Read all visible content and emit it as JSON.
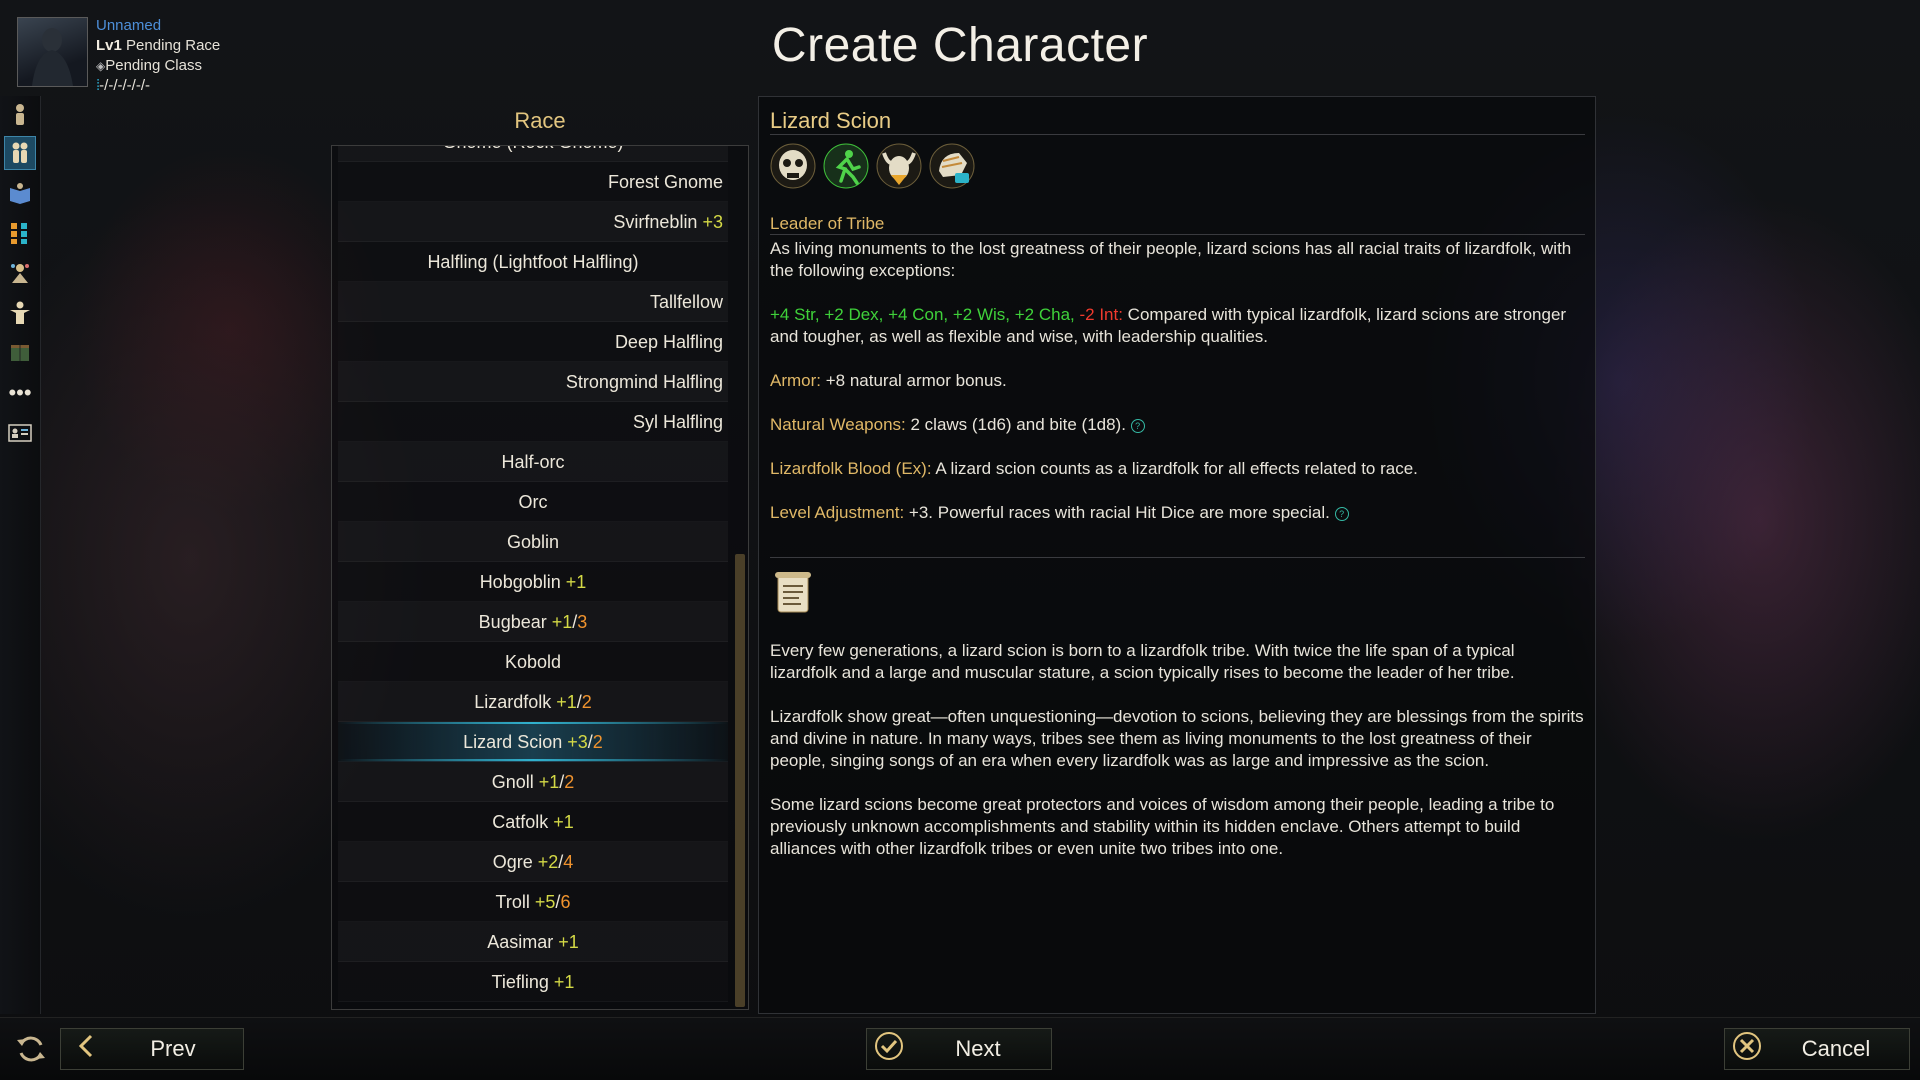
{
  "window": {
    "title": "Create Character"
  },
  "character": {
    "name": "Unnamed",
    "level_prefix": "Lv1",
    "race": "Pending Race",
    "class": "Pending Class",
    "stats": "-/-/-/-/-/-"
  },
  "sidebar": {
    "items": [
      {
        "name": "character-icon"
      },
      {
        "name": "race-icon"
      },
      {
        "name": "class-book-icon"
      },
      {
        "name": "abilities-grid-icon"
      },
      {
        "name": "skills-icon"
      },
      {
        "name": "feats-icon"
      },
      {
        "name": "spellbook-icon"
      },
      {
        "name": "more-icon"
      },
      {
        "name": "summary-card-icon"
      }
    ]
  },
  "race_panel": {
    "header": "Race",
    "rows": [
      {
        "label": "Gnome (Rock Gnome)",
        "a1": "",
        "sep": "",
        "a2": "",
        "align": "center"
      },
      {
        "label": "Forest Gnome",
        "a1": "",
        "sep": "",
        "a2": "",
        "align": "right"
      },
      {
        "label": "Svirfneblin",
        "a1": "+3",
        "sep": "",
        "a2": "",
        "align": "right"
      },
      {
        "label": "Halfling (Lightfoot Halfling)",
        "a1": "",
        "sep": "",
        "a2": "",
        "align": "center"
      },
      {
        "label": "Tallfellow",
        "a1": "",
        "sep": "",
        "a2": "",
        "align": "right"
      },
      {
        "label": "Deep Halfling",
        "a1": "",
        "sep": "",
        "a2": "",
        "align": "right"
      },
      {
        "label": "Strongmind Halfling",
        "a1": "",
        "sep": "",
        "a2": "",
        "align": "right"
      },
      {
        "label": "Syl Halfling",
        "a1": "",
        "sep": "",
        "a2": "",
        "align": "right"
      },
      {
        "label": "Half-orc",
        "a1": "",
        "sep": "",
        "a2": "",
        "align": "center"
      },
      {
        "label": "Orc",
        "a1": "",
        "sep": "",
        "a2": "",
        "align": "center"
      },
      {
        "label": "Goblin",
        "a1": "",
        "sep": "",
        "a2": "",
        "align": "center"
      },
      {
        "label": "Hobgoblin",
        "a1": "+1",
        "sep": "",
        "a2": "",
        "align": "center"
      },
      {
        "label": "Bugbear",
        "a1": "+1",
        "sep": "/",
        "a2": "3",
        "align": "center"
      },
      {
        "label": "Kobold",
        "a1": "",
        "sep": "",
        "a2": "",
        "align": "center"
      },
      {
        "label": "Lizardfolk",
        "a1": "+1",
        "sep": "/",
        "a2": "2",
        "align": "center"
      },
      {
        "label": "Lizard Scion",
        "a1": "+3",
        "sep": "/",
        "a2": "2",
        "align": "center",
        "selected": true
      },
      {
        "label": "Gnoll",
        "a1": "+1",
        "sep": "/",
        "a2": "2",
        "align": "center"
      },
      {
        "label": "Catfolk",
        "a1": "+1",
        "sep": "",
        "a2": "",
        "align": "center"
      },
      {
        "label": "Ogre",
        "a1": "+2",
        "sep": "/",
        "a2": "4",
        "align": "center"
      },
      {
        "label": "Troll",
        "a1": "+5",
        "sep": "/",
        "a2": "6",
        "align": "center"
      },
      {
        "label": "Aasimar",
        "a1": "+1",
        "sep": "",
        "a2": "",
        "align": "center"
      },
      {
        "label": "Tiefling",
        "a1": "+1",
        "sep": "",
        "a2": "",
        "align": "center"
      }
    ]
  },
  "detail": {
    "title": "Lizard Scion",
    "trait_icons": [
      "lizard-skull-icon",
      "running-figure-icon",
      "horned-helm-icon",
      "armor-glove-icon"
    ],
    "subhead": "Leader of Tribe",
    "intro": "As living monuments to the lost greatness of their people, lizard scions has all racial traits of lizardfolk, with the following exceptions:",
    "stat_bonus": "+4 Str, +2 Dex, +4 Con, +2 Wis, +2 Cha,",
    "stat_penalty": "-2 Int:",
    "stat_text": " Compared with typical lizardfolk, lizard scions are stronger and tougher, as well as flexible and wise, with leadership qualities.",
    "armor_label": "Armor:",
    "armor_text": " +8 natural armor bonus.",
    "weapons_label": "Natural Weapons:",
    "weapons_text": " 2 claws (1d6) and bite (1d8).",
    "blood_label": "Lizardfolk Blood (Ex):",
    "blood_text": " A lizard scion counts as a lizardfolk for all effects related to race.",
    "la_label": "Level Adjustment:",
    "la_text": " +3. Powerful races with racial Hit Dice are more special.",
    "help_glyph": "?",
    "lore": [
      "Every few generations, a lizard scion is born to a lizardfolk tribe. With twice the life span of a typical lizardfolk and a large and muscular stature, a scion typically rises to become the leader of her tribe.",
      "Lizardfolk show great—often unquestioning—devotion to scions, believing they are blessings from the spirits and divine in nature. In many ways, tribes see them as living monuments to the lost greatness of their people, singing songs of an era when every lizardfolk was as large and impressive as the scion.",
      "Some lizard scions become great protectors and voices of wisdom among their people, leading a tribe to previously unknown accomplishments and stability within its hidden enclave. Others attempt to build alliances with other lizardfolk tribes or even unite two tribes into one."
    ]
  },
  "footer": {
    "prev_label": "Prev",
    "next_label": "Next",
    "cancel_label": "Cancel"
  }
}
